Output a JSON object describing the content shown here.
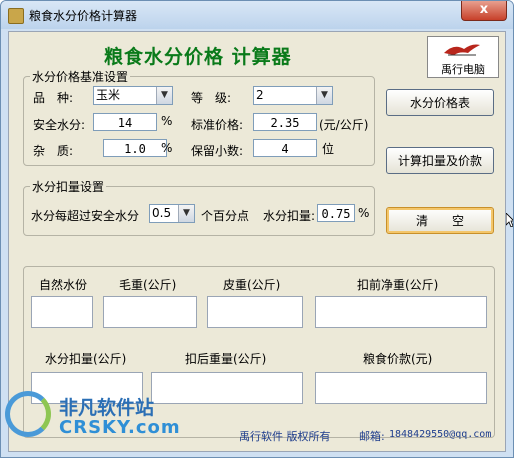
{
  "window": {
    "title": "粮食水分价格计算器",
    "close_label": "x"
  },
  "heading": "粮食水分价格 计算器",
  "logo": {
    "text": "禹行电脑"
  },
  "base_group": {
    "legend": "水分价格基准设置",
    "variety_label": "品　种:",
    "variety_value": "玉米",
    "grade_label": "等　级:",
    "grade_value": "2",
    "safe_moisture_label": "安全水分:",
    "safe_moisture_value": "14",
    "safe_moisture_unit": "%",
    "std_price_label": "标准价格:",
    "std_price_value": "2.35",
    "std_price_unit": "(元/公斤)",
    "impurity_label": "杂　质:",
    "impurity_value": "1.0",
    "impurity_unit": "%",
    "decimals_label": "保留小数:",
    "decimals_value": "4",
    "decimals_unit": "位"
  },
  "deduct_group": {
    "legend": "水分扣量设置",
    "over_label": "水分每超过安全水分",
    "over_value": "0.5",
    "over_unit": "个百分点",
    "deduct_label": "水分扣量:",
    "deduct_value": "0.75",
    "deduct_unit": "%"
  },
  "buttons": {
    "price_table": "水分价格表",
    "calculate": "计算扣量及价款",
    "clear": "清　　空"
  },
  "results": {
    "natural_moisture": "自然水份",
    "gross_weight": "毛重(公斤)",
    "tare_weight": "皮重(公斤)",
    "net_before": "扣前净重(公斤)",
    "moisture_deduct": "水分扣量(公斤)",
    "net_after": "扣后重量(公斤)",
    "grain_payment": "粮食价款(元)"
  },
  "footer": {
    "copyright": "禹行软件 版权所有",
    "email_label": "邮箱:",
    "email_value": "1848429550@qq.com"
  },
  "watermark": {
    "name": "非凡软件站",
    "site": "CRSKY.com"
  },
  "colors": {
    "heading": "#0a7a1a",
    "footer": "#1d3c8c",
    "window_bg": "#ece9d8"
  }
}
